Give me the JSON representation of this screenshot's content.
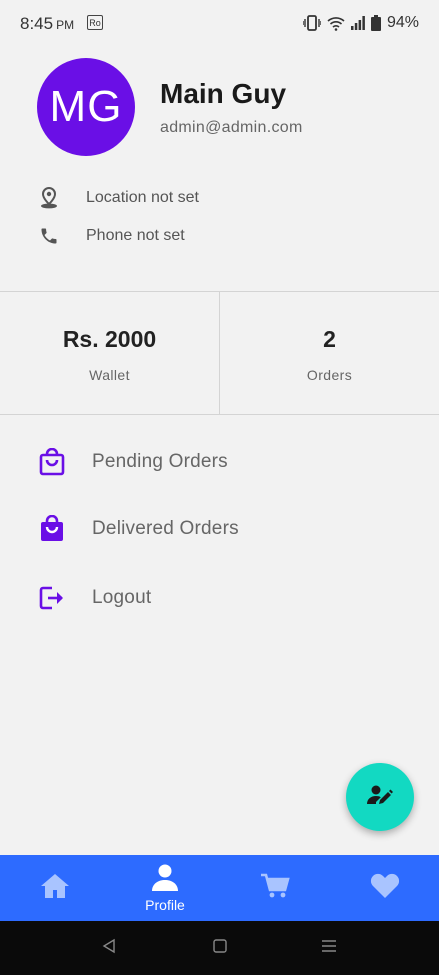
{
  "status_bar": {
    "time": "8:45",
    "ampm": "PM",
    "sim_label": "Ro",
    "battery": "94%"
  },
  "profile": {
    "initials": "MG",
    "name": "Main Guy",
    "email": "admin@admin.com",
    "location": "Location not set",
    "phone": "Phone not set"
  },
  "stats": {
    "wallet_value": "Rs. 2000",
    "wallet_label": "Wallet",
    "orders_value": "2",
    "orders_label": "Orders"
  },
  "menu": {
    "pending": "Pending Orders",
    "delivered": "Delivered Orders",
    "logout": "Logout"
  },
  "bottom_nav": {
    "profile_label": "Profile",
    "active": "profile"
  },
  "colors": {
    "accent": "#6a0fe6",
    "nav_bar": "#2d6bff",
    "fab": "#12d9c2",
    "nav_icon_inactive": "#a9c4ff"
  },
  "icons": {
    "location": "location-pin-icon",
    "phone": "phone-icon",
    "pending": "shopping-bag-outline-icon",
    "delivered": "shopping-bag-filled-icon",
    "logout": "logout-icon",
    "fab": "edit-person-icon",
    "home": "home-icon",
    "profile": "person-icon",
    "cart": "cart-icon",
    "favorites": "heart-icon"
  }
}
